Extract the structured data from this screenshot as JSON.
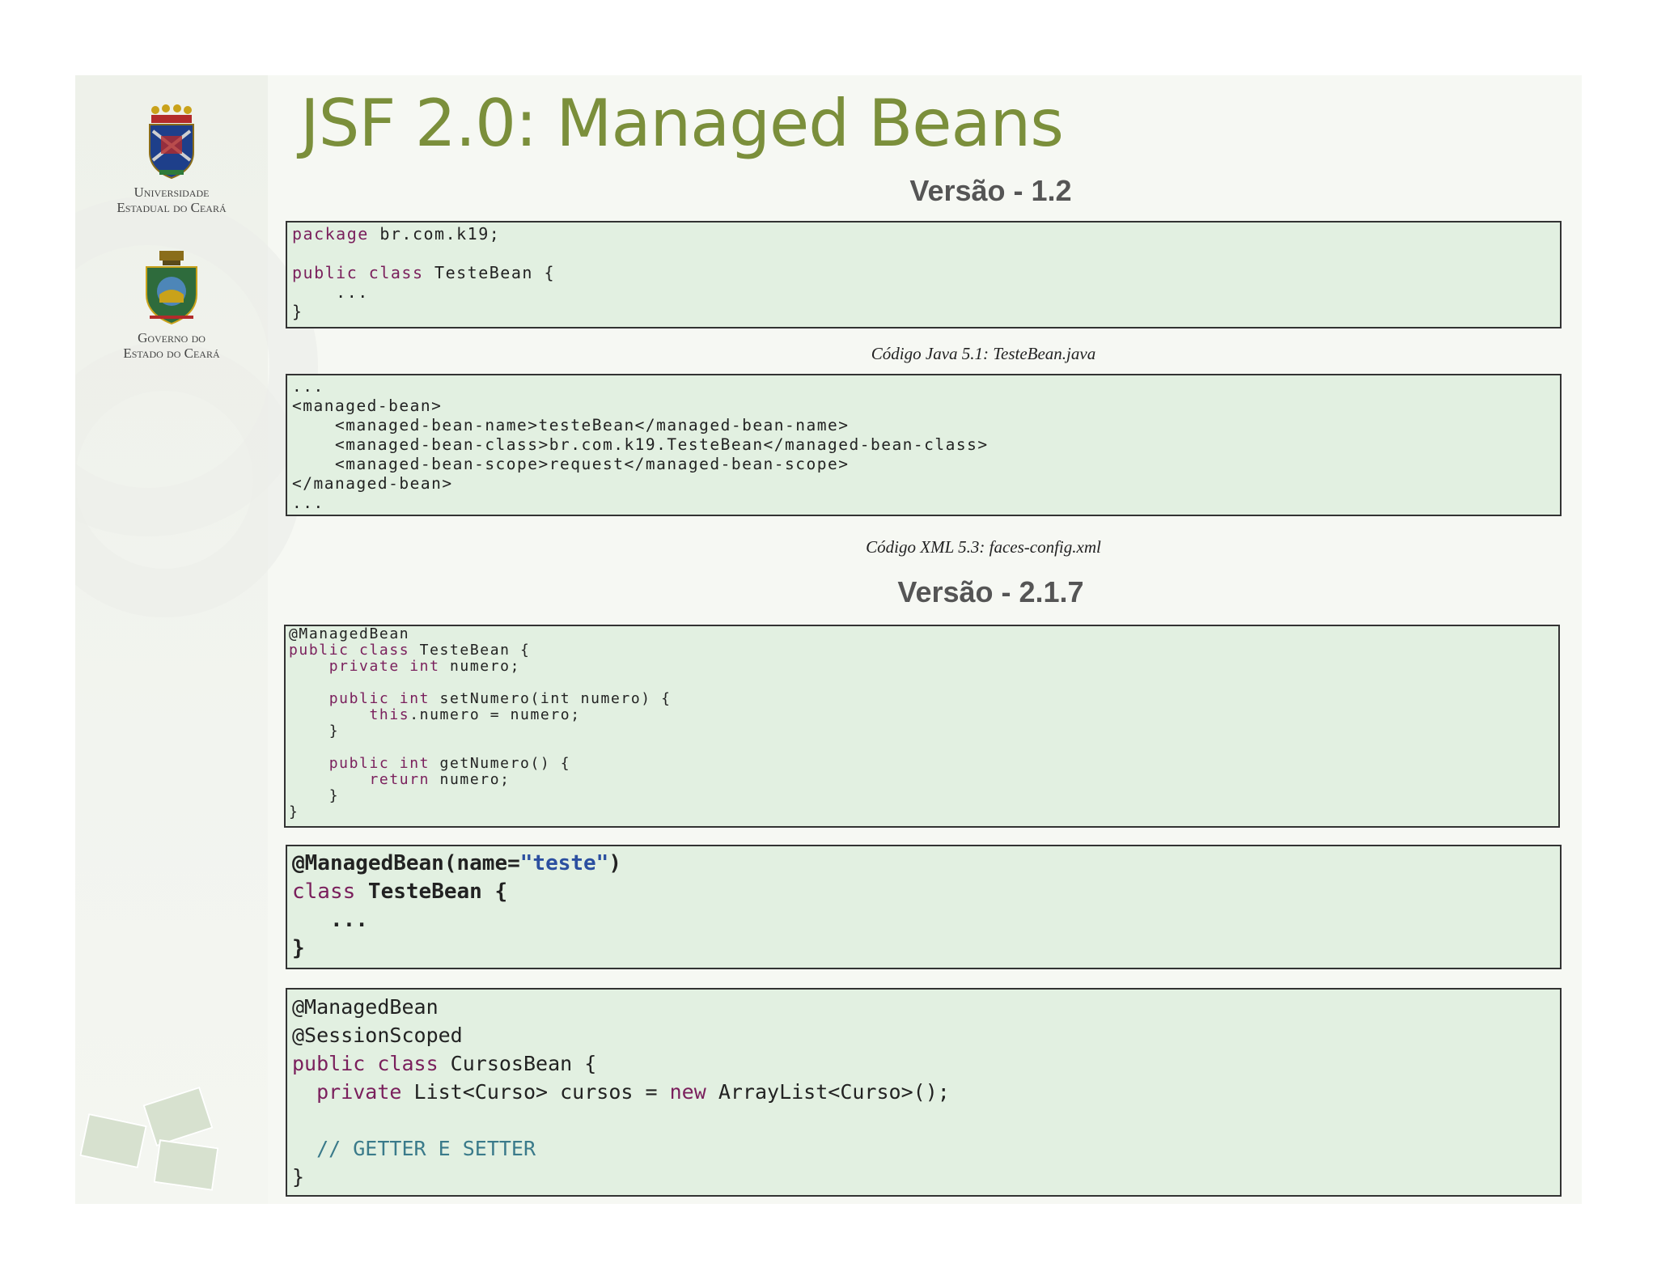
{
  "slide": {
    "title": "JSF 2.0: Managed Beans",
    "logos": {
      "university_line1": "Universidade",
      "university_line2": "Estadual do Ceará",
      "government_line1": "Governo do",
      "government_line2": "Estado do Ceará",
      "university_icon": "university-crest-icon",
      "government_icon": "state-coat-of-arms-icon"
    }
  },
  "sections": {
    "v12": {
      "heading": "Versão - 1.2",
      "java_code": {
        "lines": [
          {
            "kw": "package",
            "rest": " br.com.k19;"
          },
          {
            "kw": "",
            "rest": ""
          },
          {
            "kw": "public class",
            "rest": " TesteBean {"
          },
          {
            "kw": "",
            "rest": "    ..."
          },
          {
            "kw": "",
            "rest": "}"
          }
        ],
        "caption": "Código Java 5.1: TesteBean.java"
      },
      "xml_code": {
        "lines": [
          "...",
          "<managed-bean>",
          "    <managed-bean-name>testeBean</managed-bean-name>",
          "    <managed-bean-class>br.com.k19.TesteBean</managed-bean-class>",
          "    <managed-bean-scope>request</managed-bean-scope>",
          "</managed-bean>",
          "..."
        ],
        "caption": "Código XML 5.3: faces-config.xml"
      }
    },
    "v217": {
      "heading": "Versão - 2.1.7",
      "code_a": {
        "l1": "@ManagedBean",
        "l2_kw": "public class",
        "l2_rest": " TesteBean {",
        "l3_kw": "    private int",
        "l3_rest": " numero;",
        "l5_kw": "    public int",
        "l5_rest": " setNumero(int numero) {",
        "l6_kw": "        this",
        "l6_rest": ".numero = numero;",
        "l7": "    }",
        "l9_kw": "    public int",
        "l9_rest": " getNumero() {",
        "l10_kw": "        return",
        "l10_rest": " numero;",
        "l11": "    }",
        "l12": "}"
      },
      "code_b": {
        "l1_a": "@ManagedBean(name=",
        "l1_str": "\"teste\"",
        "l1_b": ")",
        "l2_kw": "class",
        "l2_rest": " TesteBean {",
        "l3": "   ...",
        "l4": "}"
      },
      "code_c": {
        "l1": "@ManagedBean",
        "l2": "@SessionScoped",
        "l3_kw": "public class",
        "l3_rest": " CursosBean {",
        "l4_kw": "  private",
        "l4_mid": " List<Curso> cursos = ",
        "l4_new": "new",
        "l4_end": " ArrayList<Curso>();",
        "l6": "  // GETTER E SETTER",
        "l7": "}"
      }
    }
  },
  "colors": {
    "title": "#7b8f3b",
    "code_bg": "#e2f0e1",
    "keyword": "#7a1f5c",
    "string": "#2b4fa0",
    "comment": "#3a7a8a"
  }
}
